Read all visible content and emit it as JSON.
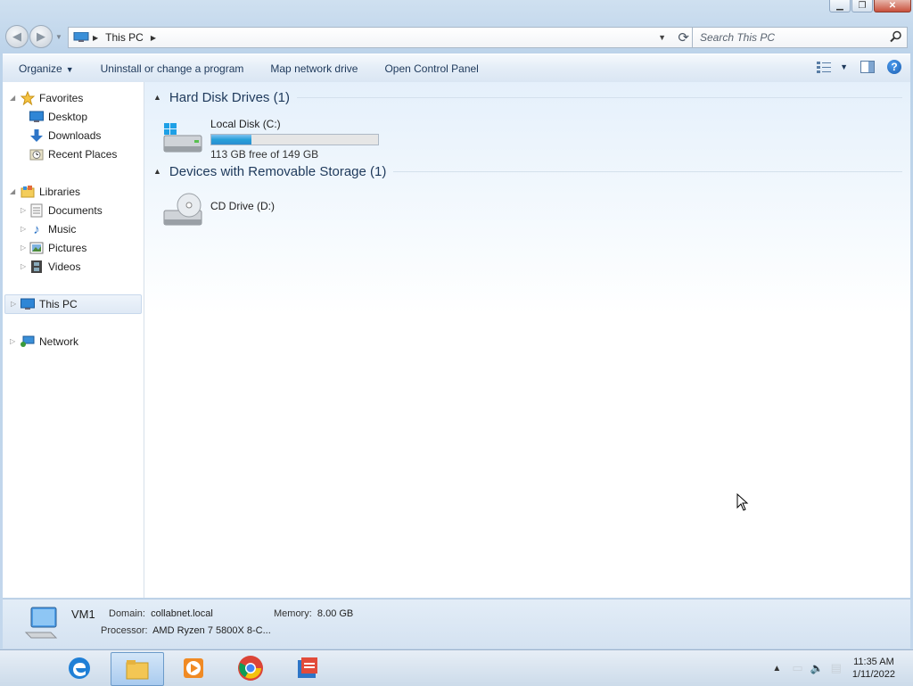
{
  "window": {
    "caption_buttons": [
      "minimize",
      "restore",
      "close"
    ]
  },
  "address": {
    "location": "This PC",
    "search_placeholder": "Search This PC"
  },
  "toolbar": {
    "organize": "Organize",
    "uninstall": "Uninstall or change a program",
    "map_drive": "Map network drive",
    "control_panel": "Open Control Panel",
    "help": "?"
  },
  "nav": {
    "favorites": "Favorites",
    "desktop": "Desktop",
    "downloads": "Downloads",
    "recent_places": "Recent Places",
    "libraries": "Libraries",
    "documents": "Documents",
    "music": "Music",
    "pictures": "Pictures",
    "videos": "Videos",
    "this_pc": "This PC",
    "network": "Network"
  },
  "content": {
    "hard_disk_header": "Hard Disk Drives (1)",
    "local_disk_name": "Local Disk (C:)",
    "local_disk_free": "113 GB free of 149 GB",
    "local_disk_used_fraction": 0.24,
    "removable_header": "Devices with Removable Storage (1)",
    "cd_drive_name": "CD Drive (D:)"
  },
  "details": {
    "computer_name": "VM1",
    "domain_label": "Domain:",
    "domain_value": "collabnet.local",
    "memory_label": "Memory:",
    "memory_value": "8.00 GB",
    "processor_label": "Processor:",
    "processor_value": "AMD Ryzen 7 5800X 8-C..."
  },
  "taskbar": {
    "time": "11:35 AM",
    "date": "1/11/2022",
    "apps": [
      "edge-icon",
      "file-explorer-icon",
      "media-player-icon",
      "chrome-icon",
      "app-icon"
    ]
  },
  "colors": {
    "progress_fill": "#26a0da",
    "header_text": "#1e395b"
  }
}
